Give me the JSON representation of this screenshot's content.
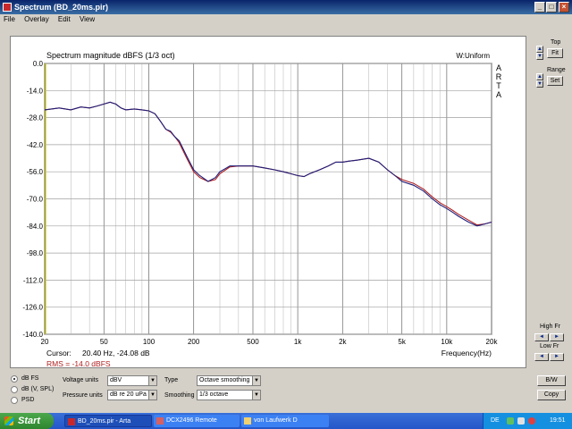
{
  "window": {
    "title": "Spectrum (BD_20ms.pir)",
    "controls": [
      "_",
      "□",
      "×"
    ]
  },
  "menu": [
    "File",
    "Overlay",
    "Edit",
    "View"
  ],
  "chart_data": {
    "type": "line",
    "title": "Spectrum magnitude dBFS (1/3 oct)",
    "window_label": "W:Uniform",
    "brand": [
      "A",
      "R",
      "T",
      "A"
    ],
    "xlabel": "Frequency(Hz)",
    "ylabel": "",
    "x_scale": "log",
    "xlim": [
      20,
      20000
    ],
    "ylim": [
      -140,
      0
    ],
    "x_ticks": [
      "20",
      "50",
      "100",
      "200",
      "500",
      "1k",
      "2k",
      "5k",
      "10k",
      "20k"
    ],
    "x_tick_values": [
      20,
      50,
      100,
      200,
      500,
      1000,
      2000,
      5000,
      10000,
      20000
    ],
    "y_ticks": [
      "0.0",
      "-14.0",
      "-28.0",
      "-42.0",
      "-56.0",
      "-70.0",
      "-84.0",
      "-98.0",
      "-112.0",
      "-126.0",
      "-140.0"
    ],
    "y_tick_values": [
      0,
      -14,
      -28,
      -42,
      -56,
      -70,
      -84,
      -98,
      -112,
      -126,
      -140
    ],
    "grid": true,
    "cursor_label": "Cursor:",
    "cursor_text": "20.40 Hz, -24.08 dB",
    "rms_text": "RMS = -14.0 dBFS",
    "series": [
      {
        "color": "#1e1e7a",
        "x": [
          20,
          25,
          30,
          35,
          40,
          45,
          50,
          55,
          60,
          65,
          70,
          80,
          90,
          100,
          110,
          120,
          130,
          140,
          150,
          160,
          180,
          200,
          220,
          250,
          280,
          300,
          350,
          400,
          500,
          600,
          700,
          800,
          900,
          1000,
          1100,
          1200,
          1400,
          1600,
          1800,
          2000,
          2200,
          2500,
          3000,
          3500,
          4000,
          4500,
          5000,
          6000,
          7000,
          8000,
          9000,
          10000,
          11000,
          12000,
          14000,
          16000,
          18000,
          20000
        ],
        "values": [
          -24,
          -23,
          -24,
          -22.5,
          -23,
          -22,
          -21,
          -20,
          -21,
          -23,
          -24,
          -23.5,
          -24,
          -24.5,
          -26,
          -30,
          -34,
          -35,
          -38,
          -40,
          -48,
          -55,
          -58,
          -61,
          -59,
          -56,
          -53,
          -53,
          -53,
          -54,
          -55,
          -56,
          -57,
          -58,
          -58.5,
          -57,
          -55,
          -53,
          -51,
          -51,
          -50.5,
          -50,
          -49,
          -51,
          -55,
          -58,
          -61,
          -63,
          -66,
          -70,
          -73,
          -75,
          -77,
          -79,
          -82,
          -84,
          -83,
          -82
        ]
      },
      {
        "color": "#b02020",
        "x": [
          20,
          25,
          30,
          35,
          40,
          45,
          50,
          55,
          60,
          65,
          70,
          80,
          90,
          100,
          110,
          120,
          130,
          140,
          150,
          160,
          180,
          200,
          220,
          250,
          280,
          300,
          350,
          400,
          500,
          600,
          700,
          800,
          900,
          1000,
          1100,
          1200,
          1400,
          1600,
          1800,
          2000,
          2200,
          2500,
          3000,
          3500,
          4000,
          4500,
          5000,
          6000,
          7000,
          8000,
          9000,
          10000,
          11000,
          12000,
          14000,
          16000,
          18000,
          20000
        ],
        "values": [
          -24,
          -23,
          -24,
          -22.5,
          -23,
          -22,
          -21,
          -20,
          -21,
          -23,
          -24,
          -23.5,
          -24,
          -24.5,
          -26,
          -30,
          -34,
          -35.5,
          -38,
          -41,
          -49,
          -56,
          -59,
          -61,
          -60,
          -57,
          -53.5,
          -53,
          -53,
          -54,
          -55,
          -56,
          -57,
          -58,
          -58.5,
          -57,
          -55,
          -53,
          -51,
          -51,
          -50.5,
          -50,
          -49,
          -51,
          -55,
          -58,
          -60,
          -62,
          -65,
          -69,
          -72,
          -74,
          -76,
          -78,
          -81,
          -83.5,
          -83,
          -82
        ]
      }
    ]
  },
  "right_panel": {
    "top_label": "Top",
    "fit_label": "Fit",
    "range_label": "Range",
    "set_label": "Set",
    "high_fr_label": "High Fr",
    "low_fr_label": "Low Fr",
    "bw_label": "B/W",
    "copy_label": "Copy"
  },
  "bottom": {
    "radios": [
      {
        "label": "dB FS",
        "checked": true
      },
      {
        "label": "dB (V, SPL)",
        "checked": false
      },
      {
        "label": "PSD",
        "checked": false
      }
    ],
    "voltage_units_label": "Voltage units",
    "voltage_units_value": "dBV",
    "pressure_units_label": "Pressure units",
    "pressure_units_value": "dB re 20 uPa",
    "type_label": "Type",
    "type_value": "Octave smoothing",
    "smoothing_label": "Smoothing",
    "smoothing_value": "1/3 octave"
  },
  "taskbar": {
    "start_label": "Start",
    "tasks": [
      "BD_20ms.pir - Arta",
      "DCX2496 Remote",
      "von Laufwerk D"
    ],
    "lang": "DE",
    "clock": "19:51"
  }
}
